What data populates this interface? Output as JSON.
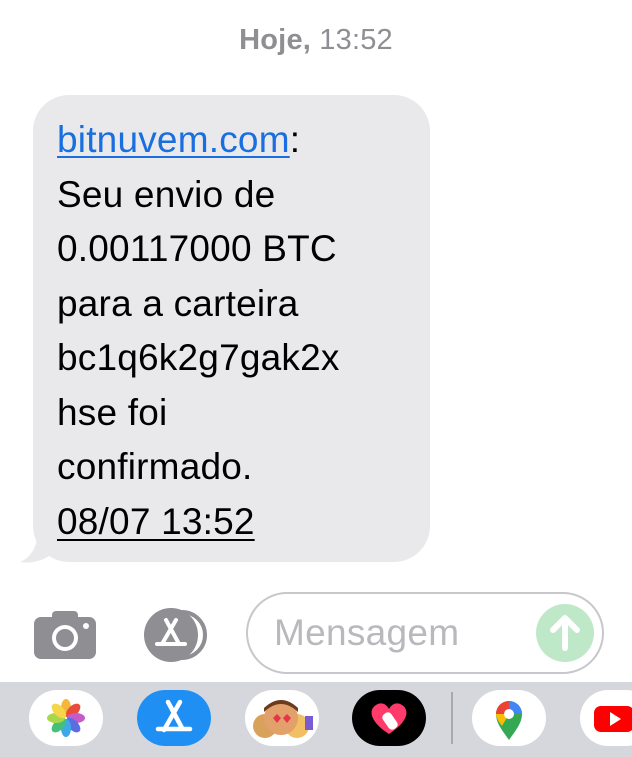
{
  "header": {
    "day": "Hoje,",
    "time": "13:52"
  },
  "message": {
    "link": "bitnuvem.com",
    "colon": ":",
    "lines": [
      "Seu envio de",
      "0.00117000 BTC",
      "para a carteira",
      "bc1q6k2g7gak2x",
      "hse foi",
      "confirmado."
    ],
    "date_link": "08/07 13:52"
  },
  "compose": {
    "placeholder": "Mensagem"
  },
  "app_drawer": {
    "apps": [
      "photos-icon",
      "app-store-icon",
      "memoji-icon",
      "digital-touch-icon",
      "google-maps-icon",
      "youtube-icon"
    ]
  },
  "colors": {
    "link": "#1a6fe0",
    "bubble": "#e9e9eb",
    "send": "#bfe8c9",
    "drawer": "#d6d7dc"
  }
}
